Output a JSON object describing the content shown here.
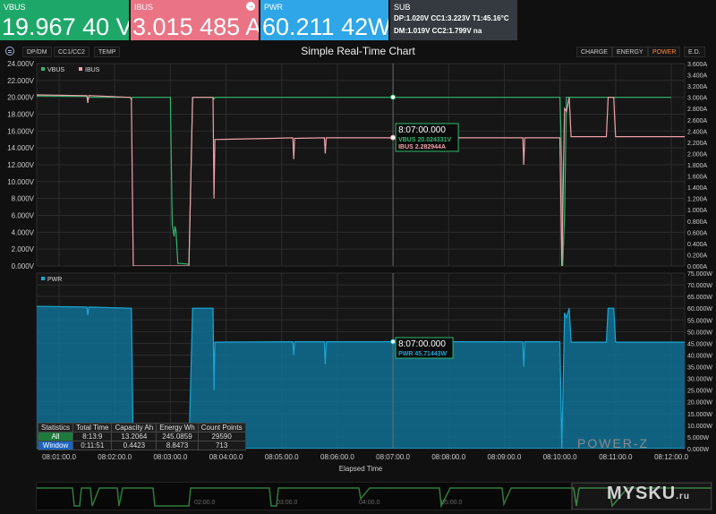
{
  "panels": {
    "vbus": {
      "label": "VBUS",
      "value": "19.967 40 V"
    },
    "ibus": {
      "label": "IBUS",
      "value": "3.015 485 A"
    },
    "pwr": {
      "label": "PWR",
      "value": "60.211 42W"
    },
    "sub": {
      "label": "SUB",
      "line1": "DP:1.020V    CC1:3.223V  T1:45.16°C",
      "line2": "DM:1.019V    CC2:1.799V  na"
    }
  },
  "toolbar": {
    "left_tabs": [
      "DP/DM",
      "CC1/CC2",
      "TEMP"
    ],
    "right_tabs": [
      "CHARGE",
      "ENERGY",
      "POWER",
      "E.D."
    ],
    "active_tab": "POWER"
  },
  "colors": {
    "vbus": "#2fb86e",
    "ibus": "#f0a0aa",
    "pwr": "#1aa6d6",
    "accent": "#ff8a3c",
    "grid": "#2c2c2c"
  },
  "chart_data": [
    {
      "type": "line",
      "title": "Simple Real-Time Chart",
      "xlabel": "Elapsed Time",
      "x_ticks": [
        "08:01:00.0",
        "08:02:00.0",
        "08:03:00.0",
        "08:04:00.0",
        "08:05:00.0",
        "08:06:00.0",
        "08:07:00.0",
        "08:08:00.0",
        "08:09:00.0",
        "08:10:00.0",
        "08:11:00.0",
        "08:12:00.0"
      ],
      "xlim_min": [
        0,
        720
      ],
      "left_axis": {
        "ylim": [
          0,
          24
        ],
        "ticks": [
          "0.000V",
          "2.000V",
          "4.000V",
          "6.000V",
          "8.000V",
          "10.000V",
          "12.000V",
          "14.000V",
          "16.000V",
          "18.000V",
          "20.000V",
          "22.000V",
          "24.000V"
        ]
      },
      "right_axis": {
        "ylim": [
          0,
          3.6
        ],
        "ticks": [
          "0.000A",
          "0.200A",
          "0.400A",
          "0.600A",
          "0.800A",
          "1.000A",
          "1.200A",
          "1.400A",
          "1.600A",
          "1.800A",
          "2.000A",
          "2.200A",
          "2.400A",
          "2.600A",
          "2.800A",
          "3.000A",
          "3.200A",
          "3.400A",
          "3.600A"
        ]
      },
      "legend": [
        "VBUS",
        "IBUS"
      ],
      "grid": true,
      "series": [
        {
          "name": "VBUS",
          "axis": "left",
          "points": [
            [
              0,
              20.2
            ],
            [
              90,
              20.1
            ],
            [
              91,
              19.6
            ],
            [
              92,
              20.0
            ],
            [
              136,
              20.0
            ],
            [
              137,
              20.0
            ],
            [
              138,
              19.7
            ],
            [
              139,
              20.0
            ],
            [
              180,
              20.0
            ],
            [
              182,
              5.0
            ],
            [
              184,
              3.5
            ],
            [
              185,
              4.7
            ],
            [
              186,
              4.2
            ],
            [
              188,
              0.3
            ],
            [
              192,
              0.3
            ],
            [
              200,
              0.2
            ],
            [
              204,
              20.0
            ],
            [
              226,
              20.0
            ],
            [
              227,
              19.8
            ],
            [
              228,
              20.0
            ],
            [
              600,
              20.0
            ],
            [
              602,
              12.0
            ],
            [
              603,
              0.0
            ],
            [
              605,
              6.0
            ],
            [
              607,
              20.0
            ],
            [
              720,
              20.0
            ]
          ]
        },
        {
          "name": "IBUS",
          "axis": "right",
          "points": [
            [
              0,
              3.05
            ],
            [
              4,
              3.25
            ],
            [
              6,
              3.05
            ],
            [
              90,
              3.03
            ],
            [
              91,
              2.9
            ],
            [
              92,
              3.03
            ],
            [
              136,
              3.0
            ],
            [
              137,
              3.0
            ],
            [
              138,
              2.95
            ],
            [
              140,
              0.0
            ],
            [
              200,
              0.0
            ],
            [
              204,
              3.0
            ],
            [
              226,
              3.0
            ],
            [
              227,
              1.2
            ],
            [
              228,
              2.25
            ],
            [
              260,
              2.26
            ],
            [
              290,
              2.27
            ],
            [
              312,
              2.28
            ],
            [
              313,
              1.9
            ],
            [
              314,
              2.27
            ],
            [
              346,
              2.28
            ],
            [
              347,
              2.0
            ],
            [
              348,
              2.28
            ],
            [
              420,
              2.28
            ],
            [
              560,
              2.28
            ],
            [
              561,
              1.8
            ],
            [
              562,
              2.28
            ],
            [
              600,
              2.28
            ],
            [
              602,
              0.0
            ],
            [
              605,
              2.8
            ],
            [
              607,
              2.75
            ],
            [
              610,
              3.0
            ],
            [
              612,
              2.3
            ],
            [
              650,
              2.3
            ],
            [
              652,
              3.0
            ],
            [
              658,
              3.0
            ],
            [
              660,
              2.3
            ],
            [
              736,
              2.3
            ],
            [
              740,
              3.0
            ],
            [
              760,
              3.0
            ]
          ]
        }
      ],
      "tooltip": {
        "time": "8:07:00.000",
        "rows": [
          "VBUS  20.024331V",
          "IBUS   2.282944A"
        ]
      }
    },
    {
      "type": "area",
      "legend": [
        "PWR"
      ],
      "right_axis": {
        "ylim": [
          0,
          75
        ],
        "ticks": [
          "0.000W",
          "5.000W",
          "10.000W",
          "15.000W",
          "20.000W",
          "25.000W",
          "30.000W",
          "35.000W",
          "40.000W",
          "45.000W",
          "50.000W",
          "55.000W",
          "60.000W",
          "65.000W",
          "70.000W",
          "75.000W"
        ]
      },
      "series": [
        {
          "name": "PWR",
          "points": [
            [
              0,
              60.5
            ],
            [
              3,
              63.5
            ],
            [
              6,
              61.0
            ],
            [
              90,
              60.5
            ],
            [
              91,
              57.0
            ],
            [
              92,
              60.5
            ],
            [
              138,
              60.0
            ],
            [
              140,
              0.0
            ],
            [
              200,
              0.0
            ],
            [
              204,
              60.0
            ],
            [
              226,
              60.0
            ],
            [
              227,
              25.0
            ],
            [
              228,
              45.5
            ],
            [
              312,
              45.7
            ],
            [
              313,
              40.0
            ],
            [
              314,
              45.7
            ],
            [
              346,
              45.7
            ],
            [
              347,
              36.0
            ],
            [
              348,
              45.7
            ],
            [
              420,
              45.7
            ],
            [
              560,
              45.7
            ],
            [
              561,
              35.0
            ],
            [
              562,
              45.7
            ],
            [
              600,
              45.7
            ],
            [
              602,
              0.0
            ],
            [
              605,
              58.0
            ],
            [
              607,
              56.0
            ],
            [
              610,
              60.0
            ],
            [
              612,
              45.5
            ],
            [
              650,
              45.5
            ],
            [
              652,
              60.0
            ],
            [
              658,
              60.0
            ],
            [
              660,
              45.5
            ],
            [
              736,
              45.5
            ],
            [
              740,
              60.0
            ],
            [
              760,
              60.0
            ]
          ]
        }
      ],
      "tooltip": {
        "time": "8:07:00.000",
        "rows": [
          "PWR  45.71443W"
        ]
      }
    }
  ],
  "statistics": {
    "headers": [
      "Statistics",
      "Total Time",
      "Capacity Ah",
      "Energy Wh",
      "Count Points"
    ],
    "rows": [
      [
        "All",
        "8:13:9",
        "13.2064",
        "245.0859",
        "29590"
      ],
      [
        "Window",
        "0:11:51",
        "0.4423",
        "8.8473",
        "713"
      ]
    ]
  },
  "overview_ticks": [
    "02:00.0",
    "03:00.0",
    "04:00.0",
    "05:00.0"
  ],
  "brand": "POWER-Z",
  "watermark": {
    "main": "MYSKU",
    "suffix": ".ru"
  }
}
